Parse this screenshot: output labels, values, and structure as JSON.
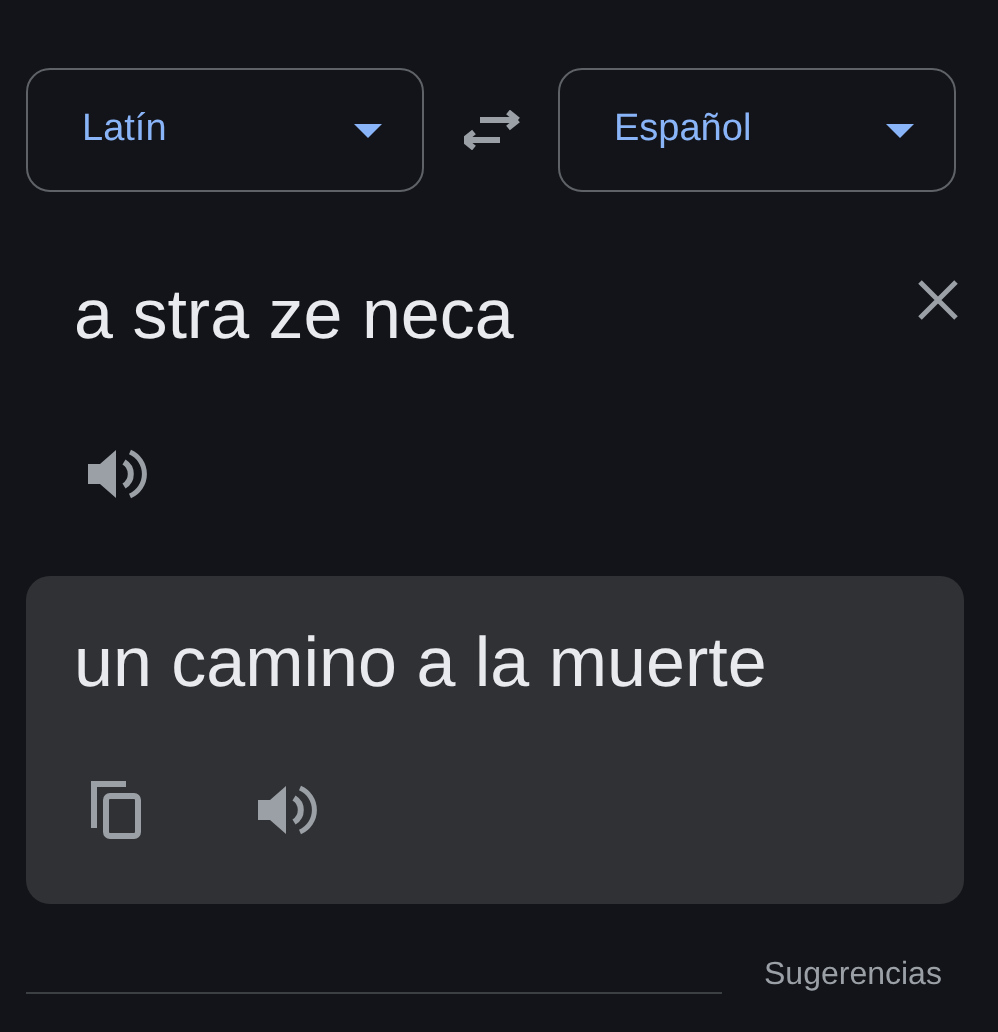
{
  "source_language": {
    "label": "Latín"
  },
  "target_language": {
    "label": "Español"
  },
  "source_text": "a stra ze neca",
  "translation": "un camino a la muerte",
  "suggestions_link": "Sugerencias"
}
